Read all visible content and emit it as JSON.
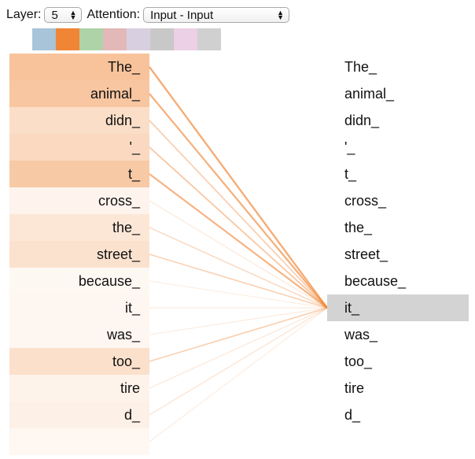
{
  "controls": {
    "layer_label": "Layer:",
    "layer_value": "5",
    "attention_label": "Attention:",
    "attention_value": "Input - Input"
  },
  "head_colors": [
    "#a8c4d8",
    "#f08535",
    "#aed3a8",
    "#e3b8b8",
    "#d8d0e0",
    "#c8c8c8",
    "#ecd0e6",
    "#d0d0d0"
  ],
  "active_head": 1,
  "line_color": "#f08535",
  "highlight_color": "#d3d3d3",
  "selected_token_index": 9,
  "tokens": [
    "The_",
    "animal_",
    "didn_",
    "'_",
    "t_",
    "cross_",
    "the_",
    "street_",
    "because_",
    "it_",
    "was_",
    "too_",
    "tire",
    "d_",
    ""
  ],
  "attention_weights": [
    0.62,
    0.58,
    0.32,
    0.38,
    0.55,
    0.08,
    0.22,
    0.28,
    0.04,
    0.06,
    0.06,
    0.3,
    0.09,
    0.12,
    0.05
  ]
}
